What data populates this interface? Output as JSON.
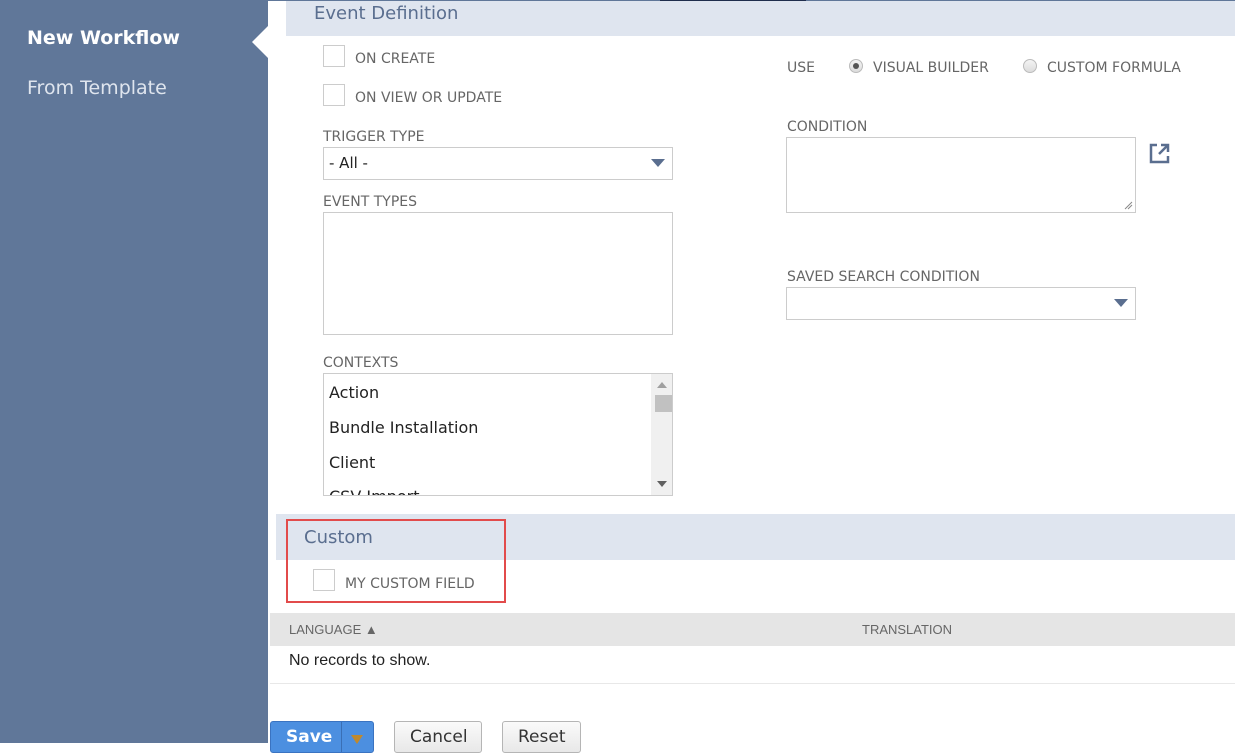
{
  "sidebar": {
    "items": [
      {
        "label": "New Workflow",
        "active": true
      },
      {
        "label": "From Template",
        "active": false
      }
    ]
  },
  "event_definition": {
    "title": "Event Definition",
    "on_create": {
      "label": "ON CREATE",
      "checked": false
    },
    "on_view_or_update": {
      "label": "ON VIEW OR UPDATE",
      "checked": false
    },
    "trigger_type": {
      "label": "TRIGGER TYPE",
      "value": "- All -"
    },
    "event_types": {
      "label": "EVENT TYPES",
      "items": []
    },
    "contexts": {
      "label": "CONTEXTS",
      "items": [
        "Action",
        "Bundle Installation",
        "Client",
        "CSV Import"
      ]
    },
    "use": {
      "label": "USE",
      "options": [
        {
          "label": "VISUAL BUILDER",
          "selected": true
        },
        {
          "label": "CUSTOM FORMULA",
          "selected": false
        }
      ]
    },
    "condition": {
      "label": "CONDITION",
      "value": "",
      "open_icon": "external-link-icon"
    },
    "saved_search_condition": {
      "label": "SAVED SEARCH CONDITION",
      "value": ""
    }
  },
  "custom": {
    "title": "Custom",
    "my_custom_field": {
      "label": "MY CUSTOM FIELD",
      "checked": false
    }
  },
  "translation_table": {
    "columns": [
      "LANGUAGE ▲",
      "TRANSLATION"
    ],
    "empty_message": "No records to show."
  },
  "actions": {
    "save_label": "Save",
    "cancel_label": "Cancel",
    "reset_label": "Reset"
  },
  "colors": {
    "sidebar_bg": "#607799",
    "section_header_bg": "#dfe5ef",
    "primary_button": "#4c8fe0",
    "highlight_box": "#e24b4b"
  }
}
